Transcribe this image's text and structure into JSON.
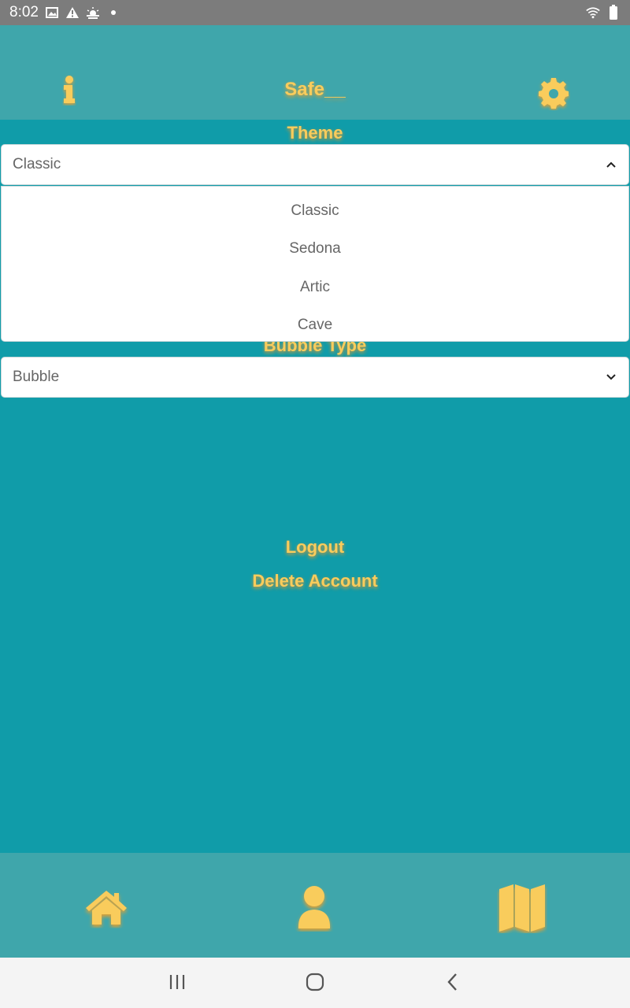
{
  "status_bar": {
    "time": "8:02",
    "left_icons": [
      "image-icon",
      "warning-icon",
      "weather-icon",
      "dot-icon"
    ],
    "right_icons": [
      "wifi-icon",
      "battery-icon"
    ]
  },
  "header": {
    "title": "Safe__",
    "info_icon": "info-icon",
    "settings_icon": "gear-icon"
  },
  "theme": {
    "label": "Theme",
    "selected": "Classic",
    "expanded": true,
    "options": [
      "Classic",
      "Sedona",
      "Artic",
      "Cave"
    ]
  },
  "bubble": {
    "label": "Bubble Type",
    "selected": "Bubble"
  },
  "actions": {
    "logout": "Logout",
    "delete_account": "Delete Account"
  },
  "bottom_nav": {
    "items": [
      "home-icon",
      "profile-icon",
      "map-icon"
    ]
  },
  "system_nav": [
    "recent-apps-icon",
    "home-circle-icon",
    "back-icon"
  ],
  "colors": {
    "accent_yellow": "#f9cc5c",
    "header_teal": "#3fa6ab",
    "body_teal": "#109ca9"
  }
}
